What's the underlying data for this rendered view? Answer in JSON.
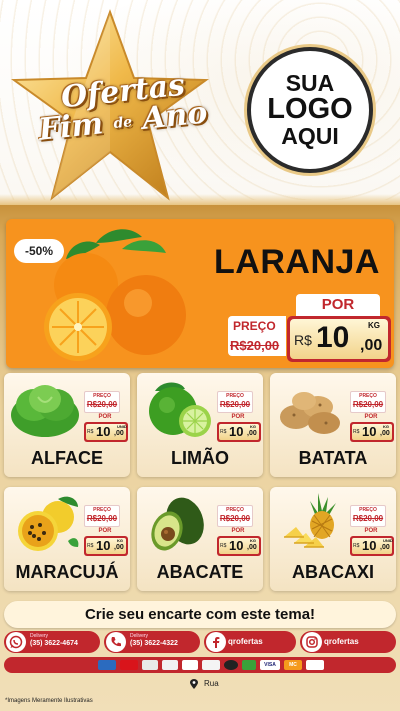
{
  "header": {
    "promo_line1": "Ofertas",
    "promo_line2a": "Fim",
    "promo_line2b": "de",
    "promo_line2c": "Ano",
    "logo_line1": "SUA",
    "logo_line2": "LOGO",
    "logo_line3": "AQUI"
  },
  "featured": {
    "discount": "-50%",
    "name": "LARANJA",
    "old_label": "PREÇO",
    "old_price": "R$20,00",
    "new_label": "POR",
    "currency": "R$",
    "price_int": "10",
    "price_cents": ",00",
    "unit": "KG"
  },
  "products": [
    {
      "name": "ALFACE",
      "old_label": "PREÇO",
      "old_price": "R$20,00",
      "new_label": "POR",
      "currency": "R$",
      "price_int": "10",
      "price_cents": ",00",
      "unit": "UNID"
    },
    {
      "name": "LIMÃO",
      "old_label": "PREÇO",
      "old_price": "R$20,00",
      "new_label": "POR",
      "currency": "R$",
      "price_int": "10",
      "price_cents": ",00",
      "unit": "KG"
    },
    {
      "name": "BATATA",
      "old_label": "PREÇO",
      "old_price": "R$20,00",
      "new_label": "POR",
      "currency": "R$",
      "price_int": "10",
      "price_cents": ",00",
      "unit": "KG"
    },
    {
      "name": "MARACUJÁ",
      "old_label": "PREÇO",
      "old_price": "R$20,00",
      "new_label": "POR",
      "currency": "R$",
      "price_int": "10",
      "price_cents": ",00",
      "unit": "KG"
    },
    {
      "name": "ABACATE",
      "old_label": "PREÇO",
      "old_price": "R$20,00",
      "new_label": "POR",
      "currency": "R$",
      "price_int": "10",
      "price_cents": ",00",
      "unit": "KG"
    },
    {
      "name": "ABACAXI",
      "old_label": "PREÇO",
      "old_price": "R$20,00",
      "new_label": "POR",
      "currency": "R$",
      "price_int": "10",
      "price_cents": ",00",
      "unit": "UNID"
    }
  ],
  "cta": "Crie seu encarte com este tema!",
  "contacts": {
    "whatsapp_label": "Delivery",
    "whatsapp_number": "(35) 3622-4674",
    "phone_label": "Delivery",
    "phone_number": "(35) 3622-4322",
    "facebook_handle": "qrofertas",
    "instagram_handle": "qrofertas"
  },
  "payments": {
    "visa": "VISA",
    "mastercard": "MC"
  },
  "address": "Rua",
  "disclaimer": "*Imagens Meramente Ilustrativas",
  "colors": {
    "brand_red": "#c1272d",
    "featured_orange": "#f7931e",
    "gold": "#d9a958"
  }
}
